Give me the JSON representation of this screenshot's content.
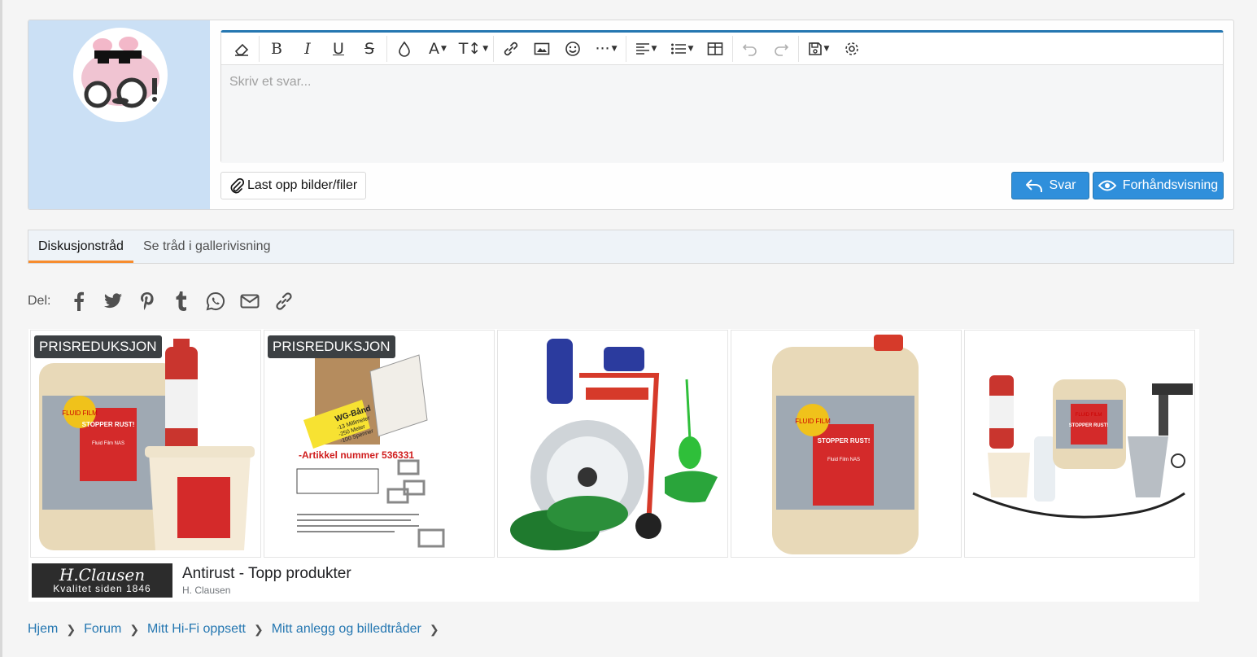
{
  "editor": {
    "placeholder": "Skriv et svar...",
    "toolbar": [
      "eraser-icon",
      "bold-icon",
      "italic-icon",
      "underline-icon",
      "strikethrough-icon",
      "color-icon",
      "font-family-icon",
      "font-size-icon",
      "link-icon",
      "image-icon",
      "smiley-icon",
      "more-icon",
      "align-icon",
      "list-icon",
      "table-icon",
      "undo-icon",
      "redo-icon",
      "drafts-icon",
      "settings-icon"
    ]
  },
  "upload": {
    "label": "Last opp bilder/filer"
  },
  "buttons": {
    "reply": "Svar",
    "preview": "Forhåndsvisning"
  },
  "tabs": [
    {
      "label": "Diskusjonstråd",
      "active": true
    },
    {
      "label": "Se tråd i gallerivisning",
      "active": false
    }
  ],
  "share": {
    "label": "Del:",
    "icons": [
      "facebook-icon",
      "twitter-icon",
      "pinterest-icon",
      "tumblr-icon",
      "whatsapp-icon",
      "email-icon",
      "link-icon"
    ]
  },
  "ad": {
    "badges": [
      "PRISREDUKSJON",
      "PRISREDUKSJON"
    ],
    "products": [
      {
        "label": "FLUID FILM",
        "text": "STOPPER RUST!",
        "details": [
          "Fluid Film NAS"
        ]
      },
      {
        "label": "WG-Bånd",
        "text": "-Artikkel nummer 536331",
        "details": [
          "-13 Millimeter",
          "-250 Meter",
          "-100 Spenner"
        ]
      },
      {
        "label": "",
        "text": "",
        "details": []
      },
      {
        "label": "FLUID FILM",
        "text": "STOPPER RUST!",
        "details": [
          "Fluid Film NAS"
        ]
      },
      {
        "label": "FLUID FILM",
        "text": "STOPPER RUST!",
        "details": []
      }
    ],
    "logo_brand": "H.Clausen",
    "logo_tagline": "Kvalitet siden 1846",
    "title": "Antirust - Topp produkter",
    "advertiser": "H. Clausen"
  },
  "breadcrumb": [
    "Hjem",
    "Forum",
    "Mitt Hi-Fi oppsett",
    "Mitt anlegg og billedtråder"
  ],
  "colors": {
    "primary": "#2f8fdb",
    "user_bg": "#cbe0f5",
    "tab_active": "#f78c2d",
    "link": "#2577b1"
  }
}
